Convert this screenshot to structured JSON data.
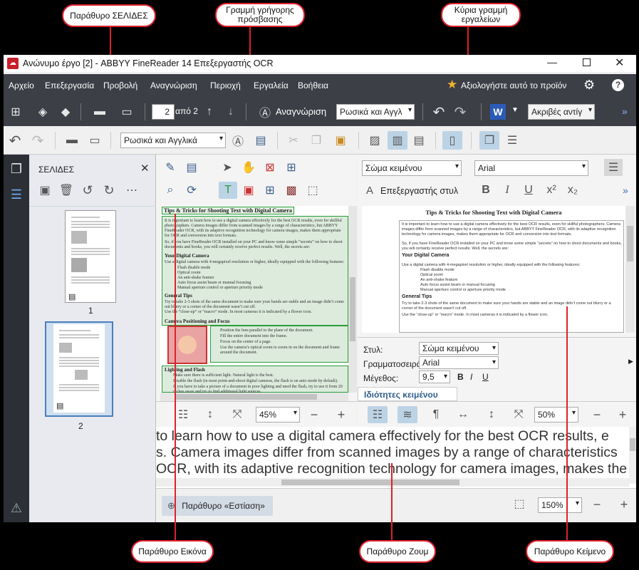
{
  "window_title": "Ανώνυμο έργο [2] - ABBYY FineReader 14 Επεξεργαστής OCR",
  "menu": [
    "Αρχείο",
    "Επεξεργασία",
    "Προβολή",
    "Αναγνώριση",
    "Περιοχή",
    "Εργαλεία",
    "Βοήθεια"
  ],
  "rate_product": "Αξιολογήστε αυτό το προϊόν",
  "toolbar": {
    "page_number": "2",
    "page_of": "από 2",
    "recognize": "Αναγνώριση",
    "language": "Ρωσικά και Αγγλ",
    "copy_mode": "Ακριβές αντίγ",
    "word_icon": "W"
  },
  "quick_toolbar": {
    "language": "Ρωσικά και Αγγλικά"
  },
  "pages_pane": {
    "title": "ΣΕΛΙΔΕΣ",
    "page1": "1",
    "page2": "2"
  },
  "image_pane": {
    "doc_title": "Tips & Tricks for Shooting Text with Digital Camera",
    "para1": "It is important to learn how to use a digital camera effectively for the best OCR results, even for skillful photographers. Camera images differ from scanned images by a range of characteristics, but ABBYY FineReader OCR, with its adaptive recognition technology for camera images, makes them appropriate for OCR and conversion into text formats.",
    "para2": "So, if you have FineReader OCR installed on your PC and know some simple “secrets” on how to shoot documents and books, you will certainly receive perfect results. Well, the secrets are:",
    "h_camera": "Your Digital Camera",
    "camera_intro": "Use a digital camera with 4-megapixel resolution or higher, ideally equipped with the following features:",
    "features": [
      "Flash disable mode",
      "Optical zoom",
      "An anti-shake feature",
      "Auto focus assist beam or manual focusing",
      "Manual aperture control or aperture priority mode"
    ],
    "h_general": "General Tips",
    "general_text": "Try to take 2-3 shots of the same document to make sure your hands are stable and an image didn’t come out blurry or a corner of the document wasn’t cut off.",
    "closeup": "Use the “close-up” or “macro” mode. In most cameras it is indicated by a flower icon.",
    "h_position": "Camera Positioning and Focus",
    "position_items": [
      "Position the lens parallel to the plane of the document.",
      "Fill the entire document into the frame.",
      "Focus on the center of a page.",
      "Use the camera’s optical zoom to zoom in on the document and frame around the document."
    ],
    "h_light": "Lighting and Flash",
    "light_items": [
      "Make sure there is sufficient light. Natural light is the best.",
      "Disable the flash (in most point-and-shoot digital cameras, the flash is on auto mode by default).",
      "If you have to take a picture of a document in poor lighting and need the flash, try to use it from 20 inches away and try to find additional light sources."
    ],
    "zoom": "45%"
  },
  "text_pane": {
    "style": "Σώμα κειμένου",
    "font": "Arial",
    "style_editor": "Επεξεργαστής στυλ",
    "doc_title": "Tips & Tricks for Shooting Text with Digital Camera",
    "props": {
      "style_label": "Στυλ:",
      "style_value": "Σώμα κειμένου",
      "font_label": "Γραμματοσειρά:",
      "font_value": "Arial",
      "size_label": "Μέγεθος:",
      "size_value": "9,5"
    },
    "props_tab": "Ιδιότητες κειμένου",
    "zoom": "50%"
  },
  "zoom_pane": {
    "line1": "to learn how to use a digital camera effectively for the best OCR results, e",
    "line2": "s. Camera images differ from scanned images by a range of characteristics",
    "line3": "OCR, with its adaptive recognition technology for camera images, makes the",
    "focus_button": "Παράθυρο «Εστίαση»",
    "zoom": "150%"
  },
  "callouts": {
    "pages": "Παράθυρο ΣΕΛΙΔΕΣ",
    "quick": "Γραμμή γρήγορης πρόσβασης",
    "main_toolbar": "Κύρια γραμμή εργαλείων",
    "image": "Παράθυρο Εικόνα",
    "zoom": "Παράθυρο Ζουμ",
    "text": "Παράθυρο Κείμενο"
  },
  "colors": {
    "dark_toolbar": "#3c3f46",
    "callout_red": "#e0202a",
    "green_block": "#2a9d3a",
    "select_blue": "#3b6fb6"
  }
}
